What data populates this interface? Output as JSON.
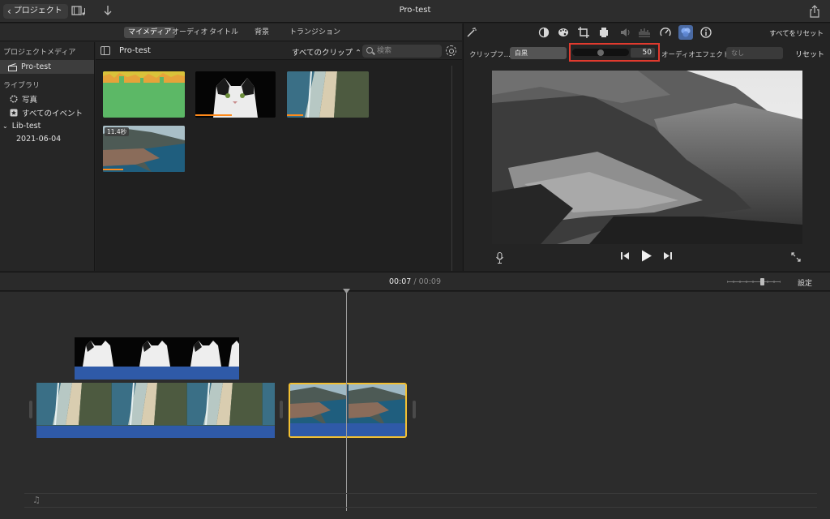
{
  "titlebar": {
    "back_label": "プロジェクト",
    "title": "Pro-test",
    "icons": [
      "film-music-icon",
      "import-arrow-icon",
      "share-icon"
    ]
  },
  "media_tabs": [
    "マイメディア",
    "オーディオ",
    "タイトル",
    "背景",
    "トランジション"
  ],
  "sidebar": {
    "project_header": "プロジェクトメディア",
    "project_item": "Pro-test",
    "library_header": "ライブラリ",
    "photos": "写真",
    "all_events": "すべてのイベント",
    "library": "Lib-test",
    "event_date": "2021-06-04"
  },
  "browser": {
    "title": "Pro-test",
    "filter": "すべてのクリップ ⌃",
    "search_placeholder": "検索",
    "clip_duration_badge": "11.4秒",
    "clip_progress": [
      0.0,
      0.45,
      0.2,
      0.25
    ]
  },
  "viewer": {
    "reset_all": "すべてをリセット",
    "clip_filter_label": "クリップフ…",
    "clip_filter_value": "白黒",
    "slider_value": "50",
    "audio_effect_label": "オーディオエフェクト:",
    "audio_effect_value": "なし",
    "reset": "リセット",
    "slider_fraction": 0.5
  },
  "timeline": {
    "current": "00:07",
    "separator": "/",
    "total": "00:09",
    "settings": "設定",
    "zoom_fraction": 0.65
  },
  "colors": {
    "accent_selected": "#f3c032",
    "audio_blue": "#2f5aa8",
    "highlight": "#e13a2e",
    "progress_orange": "#ff8a1a"
  }
}
